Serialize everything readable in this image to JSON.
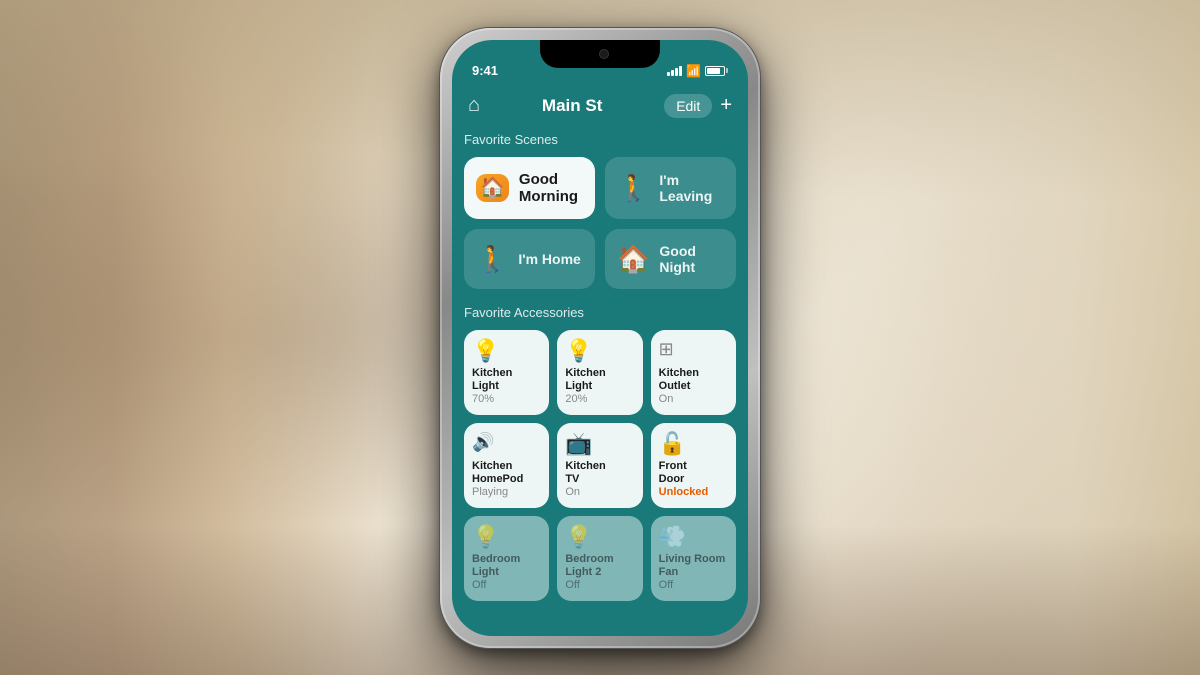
{
  "background": {
    "color": "#c8b89a"
  },
  "phone": {
    "status_bar": {
      "time": "9:41",
      "signal_label": "signal",
      "wifi_label": "wifi",
      "battery_label": "battery"
    },
    "nav": {
      "home_icon": "⌂",
      "title": "Main St",
      "edit_label": "Edit",
      "add_icon": "+"
    },
    "favorite_scenes": {
      "section_title": "Favorite Scenes",
      "scenes": [
        {
          "id": "good-morning",
          "icon": "🏠",
          "icon_bg": "#f5a623",
          "label": "Good Morning",
          "style": "white"
        },
        {
          "id": "im-leaving",
          "icon": "🚶",
          "label": "I'm Leaving",
          "style": "teal"
        },
        {
          "id": "im-home",
          "icon": "🚶",
          "label": "I'm Home",
          "style": "teal"
        },
        {
          "id": "good-night",
          "icon": "🏠",
          "label": "Good Night",
          "style": "teal"
        }
      ]
    },
    "favorite_accessories": {
      "section_title": "Favorite Accessories",
      "accessories": [
        {
          "id": "kitchen-light-1",
          "icon": "💡",
          "name": "Kitchen\nLight",
          "status": "70%",
          "status_type": "normal",
          "dim": false
        },
        {
          "id": "kitchen-light-2",
          "icon": "💡",
          "name": "Kitchen\nLight",
          "status": "20%",
          "status_type": "normal",
          "dim": false
        },
        {
          "id": "kitchen-outlet",
          "icon": "🔌",
          "name": "Kitchen\nOutlet",
          "status": "On",
          "status_type": "normal",
          "dim": false
        },
        {
          "id": "kitchen-homepod",
          "icon": "🔊",
          "name": "Kitchen\nHomePod",
          "status": "Playing",
          "status_type": "normal",
          "dim": false
        },
        {
          "id": "kitchen-tv",
          "icon": "📺",
          "name": "Kitchen\nTV",
          "status": "On",
          "status_type": "normal",
          "dim": false
        },
        {
          "id": "front-door",
          "icon": "🔓",
          "name": "Front\nDoor",
          "status": "Unlocked",
          "status_type": "unlocked",
          "dim": false
        },
        {
          "id": "bedroom-light",
          "icon": "💡",
          "name": "Bedroom\nLight",
          "status": "Off",
          "status_type": "normal",
          "dim": true
        },
        {
          "id": "bedroom-light-2",
          "icon": "💡",
          "name": "Bedroom\nLight 2",
          "status": "Off",
          "status_type": "normal",
          "dim": true
        },
        {
          "id": "living-room-fan",
          "icon": "💨",
          "name": "Living Room\nFan",
          "status": "Off",
          "status_type": "normal",
          "dim": true
        }
      ]
    }
  }
}
